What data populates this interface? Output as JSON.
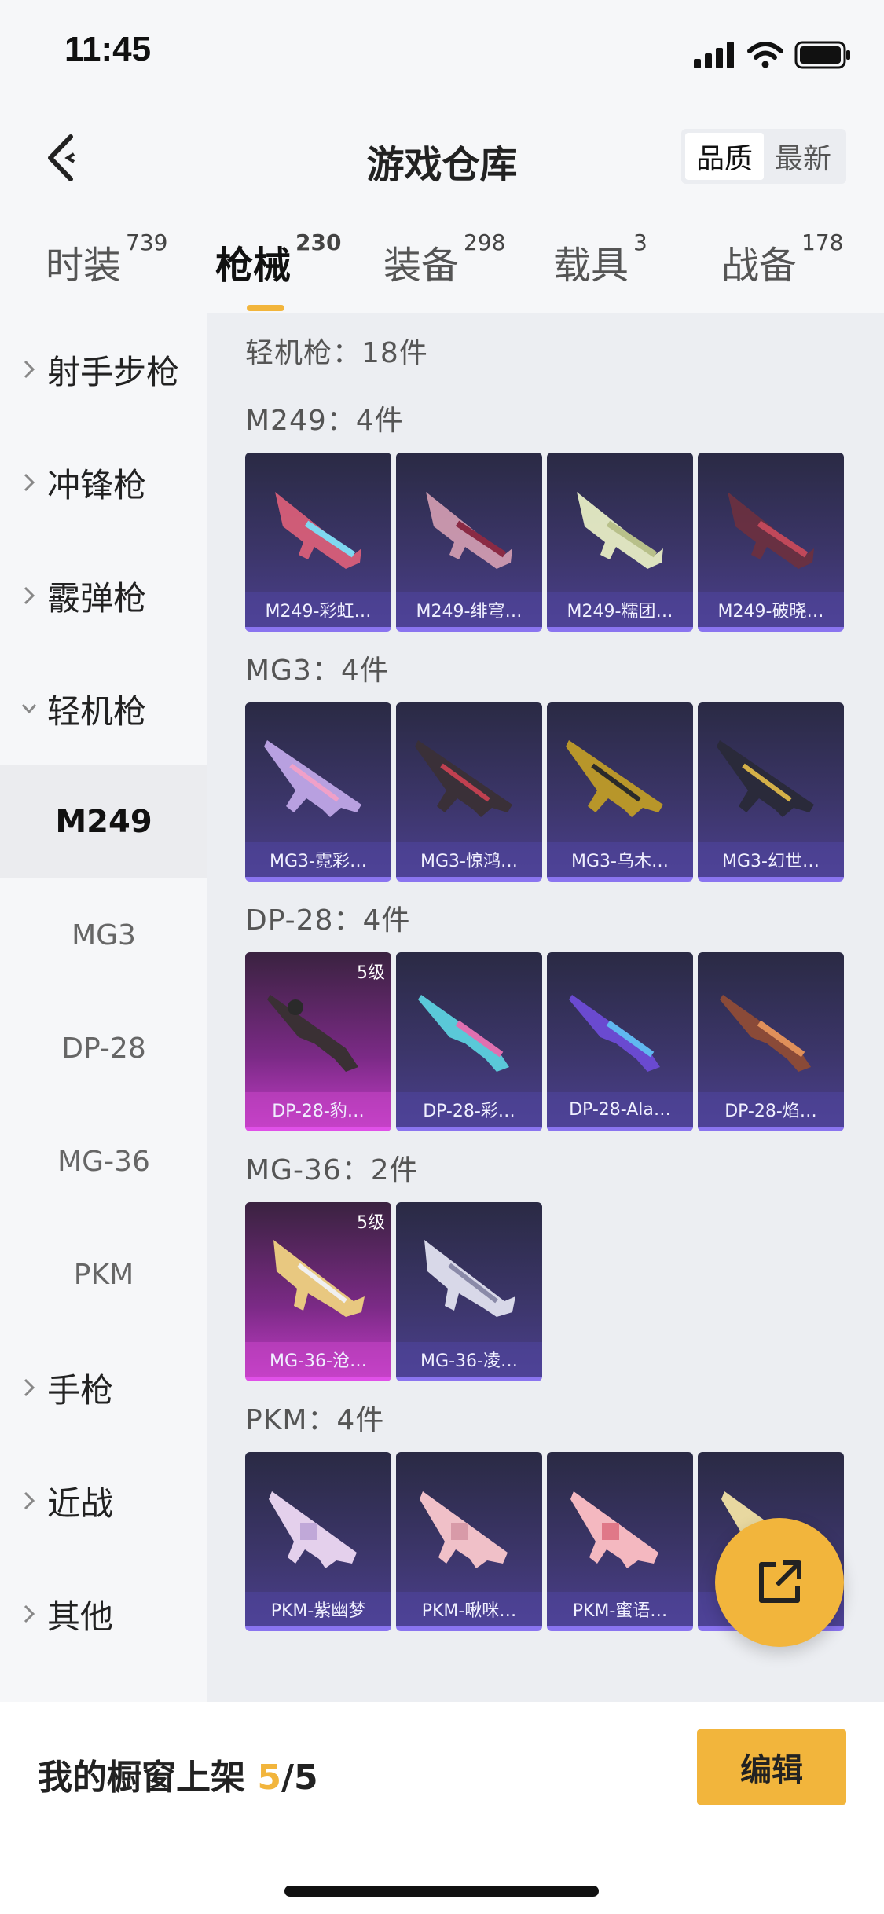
{
  "status_bar": {
    "time": "11:45"
  },
  "header": {
    "title": "游戏仓库",
    "sort_options": [
      "品质",
      "最新"
    ],
    "sort_active": "品质"
  },
  "tabs": [
    {
      "label": "时装",
      "count": "739"
    },
    {
      "label": "枪械",
      "count": "230"
    },
    {
      "label": "装备",
      "count": "298"
    },
    {
      "label": "载具",
      "count": "3"
    },
    {
      "label": "战备",
      "count": "178"
    }
  ],
  "sidebar": {
    "categories": [
      "射手步枪",
      "冲锋枪",
      "霰弹枪",
      "轻机枪",
      "手枪",
      "近战",
      "其他"
    ],
    "subitems": [
      "M249",
      "MG3",
      "DP-28",
      "MG-36",
      "PKM"
    ]
  },
  "content": {
    "summary": "轻机枪：18件",
    "groups": [
      {
        "title": "M249：4件",
        "items": [
          "M249-彩虹…",
          "M249-绯穹…",
          "M249-糯团…",
          "M249-破晓…"
        ]
      },
      {
        "title": "MG3：4件",
        "items": [
          "MG3-霓彩…",
          "MG3-惊鸿…",
          "MG3-乌木…",
          "MG3-幻世…"
        ]
      },
      {
        "title": "DP-28：4件",
        "items": [
          "DP-28-豹…",
          "DP-28-彩…",
          "DP-28-Ala…",
          "DP-28-焰…"
        ],
        "level": "5级"
      },
      {
        "title": "MG-36：2件",
        "items": [
          "MG-36-沧…",
          "MG-36-凌…"
        ],
        "level": "5级"
      },
      {
        "title": "PKM：4件",
        "items": [
          "PKM-紫幽梦",
          "PKM-啾咪…",
          "PKM-蜜语…",
          ""
        ]
      }
    ]
  },
  "bottom": {
    "showcase_prefix": "我的橱窗上架 ",
    "showcase_count": "5",
    "showcase_total": "/5",
    "edit_label": "编辑"
  },
  "colors": {
    "accent": "#f2b53c",
    "card_purple": "#3b3568",
    "card_pink": "#c03cc4"
  }
}
